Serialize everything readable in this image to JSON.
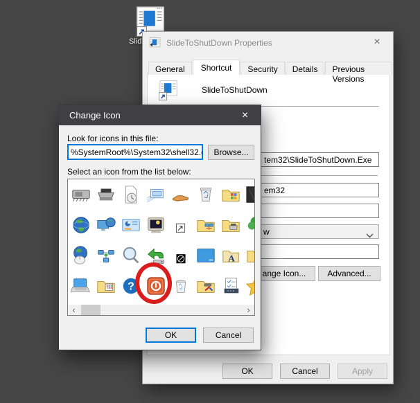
{
  "colors": {
    "accent": "#0078d7",
    "annotation": "#da1c1c",
    "desktop": "#464646",
    "titlebar": "#404043"
  },
  "desktop": {
    "shortcut_label": "Slid"
  },
  "properties_dialog": {
    "title": "SlideToShutDown Properties",
    "close_glyph": "×",
    "tabs": [
      {
        "label": "General",
        "active": false
      },
      {
        "label": "Shortcut",
        "active": true
      },
      {
        "label": "Security",
        "active": false
      },
      {
        "label": "Details",
        "active": false
      },
      {
        "label": "Previous Versions",
        "active": false
      }
    ],
    "shortcut_name": "SlideToShutDown",
    "fields": {
      "target_visible": "tem32\\SlideToShutDown.Exe",
      "start_in_visible": "em32",
      "shortcut_key_visible": "",
      "run_visible": "w",
      "comment_visible": ""
    },
    "buttons": {
      "change_icon_visible": "ange Icon...",
      "advanced": "Advanced...",
      "ok": "OK",
      "cancel": "Cancel",
      "apply": "Apply"
    }
  },
  "change_icon_dialog": {
    "title": "Change Icon",
    "close_glyph": "×",
    "look_for_label": "Look for icons in this file:",
    "path_value": "%SystemRoot%\\System32\\shell32.c",
    "browse_button": "Browse...",
    "select_label": "Select an icon from the list below:",
    "icon_grid": {
      "rows": 4,
      "cols": 8,
      "icons": [
        [
          "memory-chip",
          "printer",
          "document-clock",
          "install-windows",
          "sharing-hand",
          "recycle-bin-full",
          "folder-programs",
          "screen-dark"
        ],
        [
          "globe-internet",
          "monitor-globe",
          "control-panel",
          "monitor-screensaver",
          "shortcut-overlay",
          "folder-network",
          "folder-printer",
          "tree"
        ],
        [
          "globe-mouse",
          "network-nodes",
          "magnifier",
          "undo-drive",
          "clock-overlay",
          "display-blue",
          "folder-fonts",
          "folder-plain"
        ],
        [
          "laptop",
          "folder-apps",
          "help-question",
          "power-button",
          "recycle-bin-empty",
          "folder-tools",
          "task-checklist",
          "star"
        ]
      ],
      "annotated_icon": "power-button"
    },
    "scrollbar": {
      "left_glyph": "‹",
      "right_glyph": "›"
    },
    "ok_button": "OK",
    "cancel_button": "Cancel"
  }
}
